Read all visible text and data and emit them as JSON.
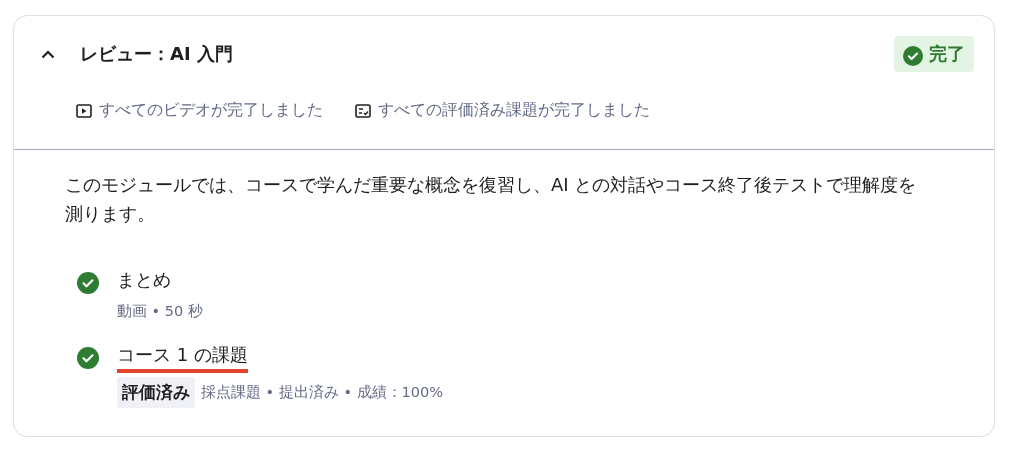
{
  "module": {
    "title": "レビュー：AI 入門",
    "expanded": true,
    "status": {
      "label": "完了",
      "completed": true
    },
    "summary": [
      {
        "kind": "video",
        "label": "すべてのビデオが完了しました"
      },
      {
        "kind": "graded",
        "label": "すべての評価済み課題が完了しました"
      }
    ],
    "description": "このモジュールでは、コースで学んだ重要な概念を復習し、AI との対話やコース終了後テストで理解度を測ります。",
    "items": [
      {
        "title": "まとめ",
        "completed": true,
        "underlined": false,
        "meta": "動画 • 50 秒"
      },
      {
        "title": "コース 1 の課題",
        "completed": true,
        "underlined": true,
        "tag": "評価済み",
        "meta": "採点課題 • 提出済み • 成績：100%"
      }
    ]
  }
}
